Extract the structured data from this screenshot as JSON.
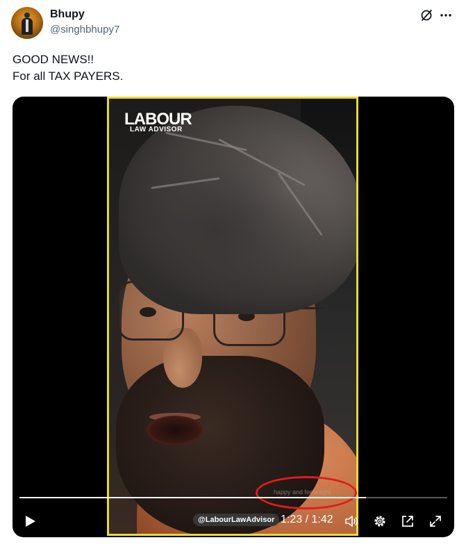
{
  "author": {
    "display_name": "Bhupy",
    "handle": "@singhbhupy7"
  },
  "icons": {
    "grok": "grok-icon",
    "more": "more-icon",
    "play": "play-icon",
    "volume": "volume-icon",
    "settings": "gear-icon",
    "pip": "picture-in-picture-icon",
    "fullscreen": "fullscreen-icon"
  },
  "tweet": {
    "lines": [
      "GOOD NEWS!!",
      "For all TAX PAYERS."
    ]
  },
  "video": {
    "logo_line1": "LABOUR",
    "logo_line2": "LAW ADVISOR",
    "subtitle": "happy and feels light",
    "watermark": "@LabourLawAdvisor",
    "time": "1:23 / 1:42",
    "progress": 0.81,
    "frame_border_color": "#e8dc2e",
    "annotation_color": "#e21b1b"
  }
}
